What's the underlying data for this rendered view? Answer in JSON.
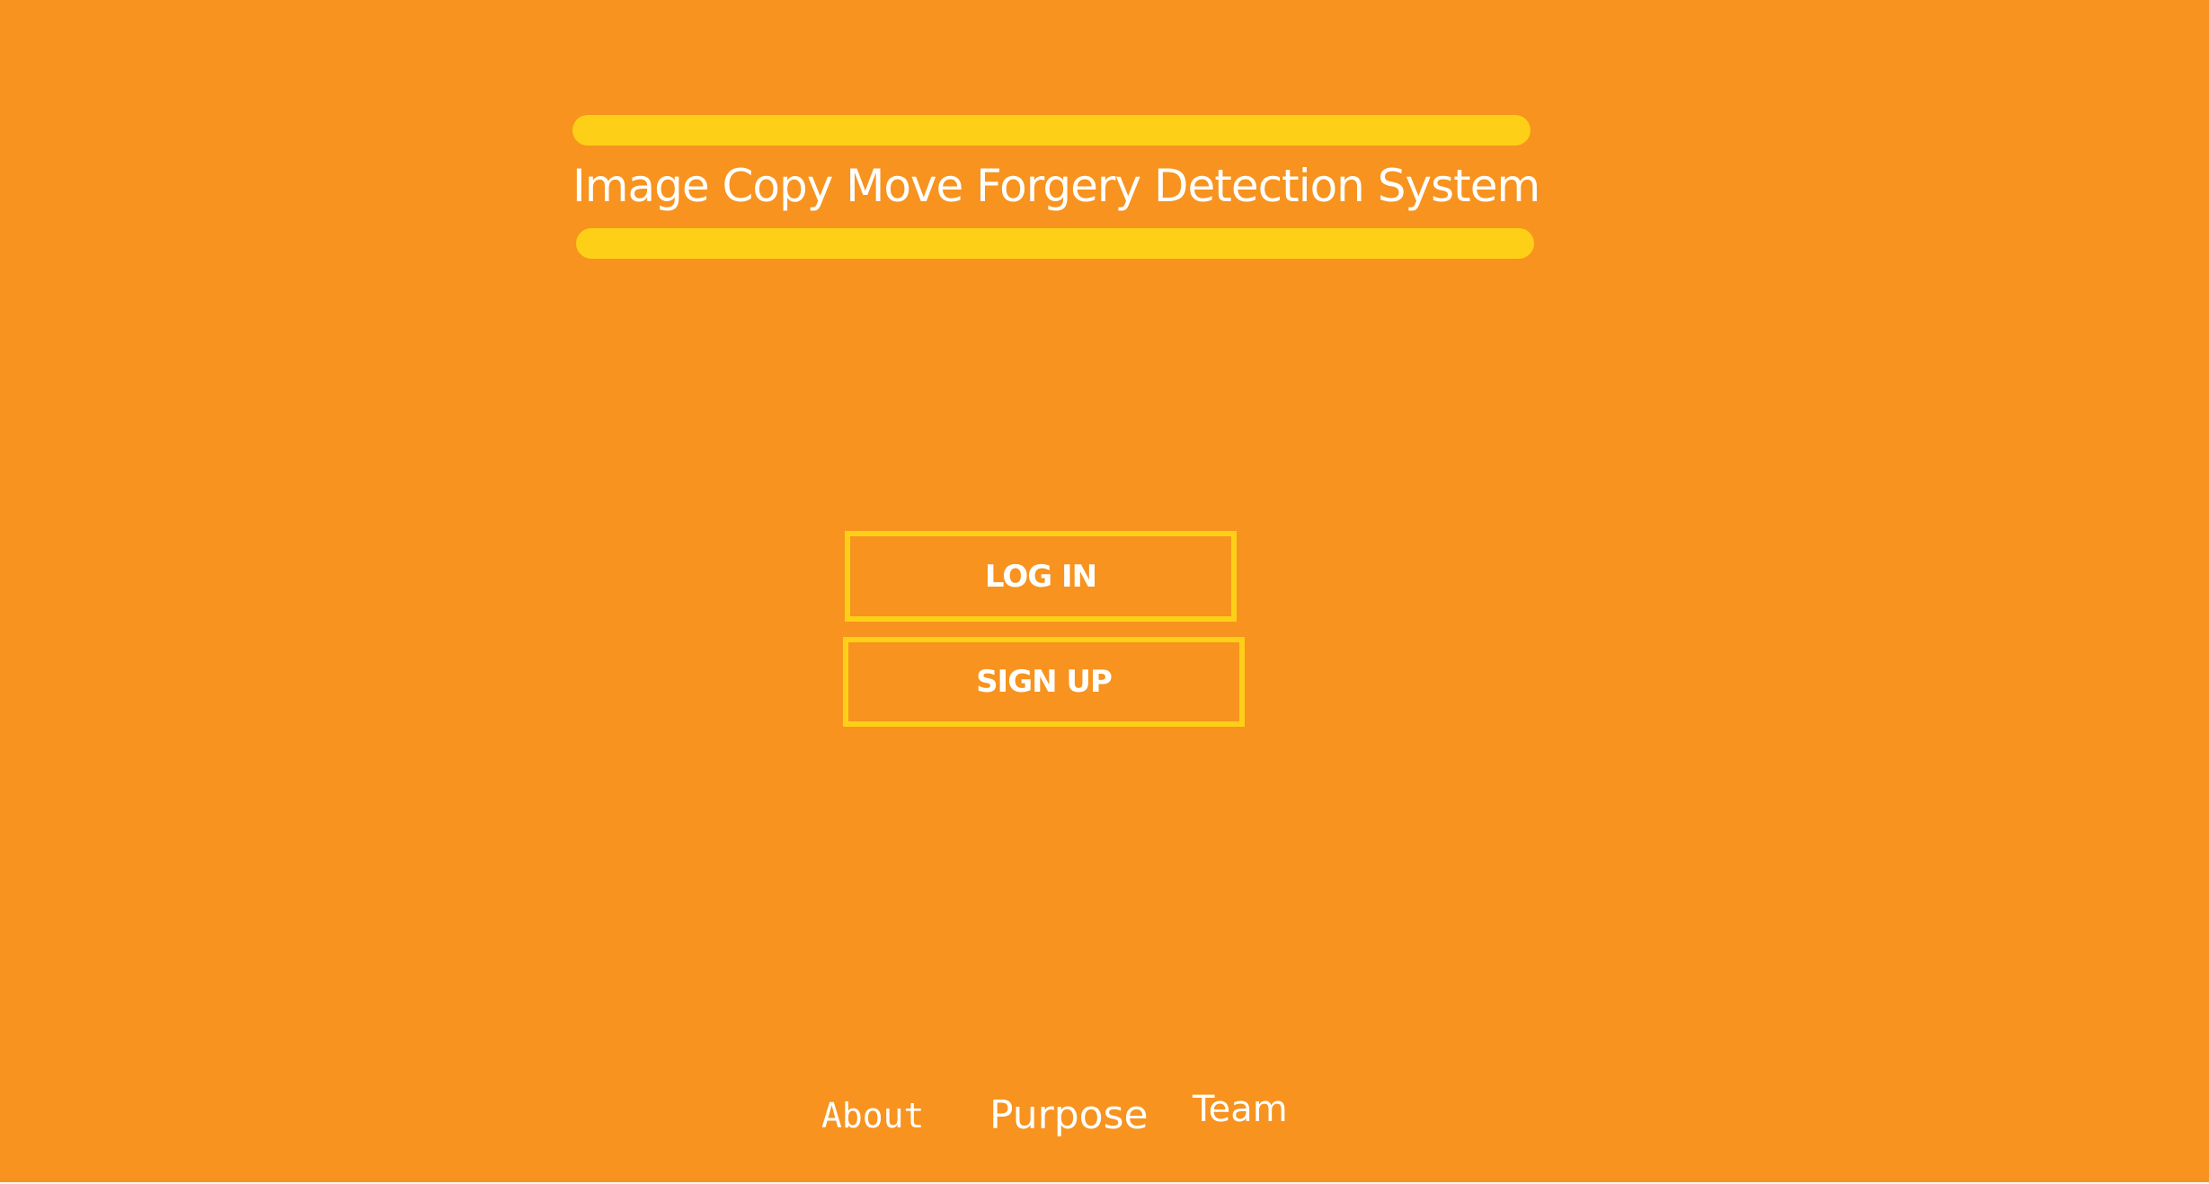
{
  "header": {
    "title": "Image Copy Move Forgery Detection System"
  },
  "actions": {
    "login_label": "LOG IN",
    "signup_label": "SIGN UP"
  },
  "footer": {
    "links": [
      {
        "label": "About"
      },
      {
        "label": "Purpose"
      },
      {
        "label": "Team"
      }
    ]
  },
  "colors": {
    "background": "#F7931E",
    "accent": "#FDD017",
    "text": "#FFFFFF"
  }
}
